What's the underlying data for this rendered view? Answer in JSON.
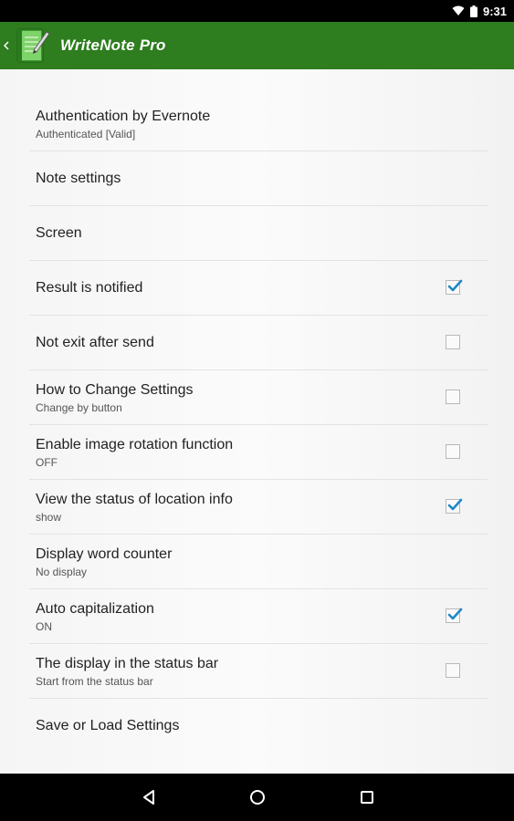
{
  "status_bar": {
    "time": "9:31",
    "icons": [
      "wifi-icon",
      "battery-icon"
    ]
  },
  "action_bar": {
    "title": "WriteNote Pro",
    "color": "#2e7d1f",
    "icons": [
      "up-chevron-icon",
      "app-notebook-icon"
    ]
  },
  "settings": [
    {
      "title": "Authentication by Evernote",
      "summary": "Authenticated [Valid]",
      "checkbox": null
    },
    {
      "title": "Note settings",
      "summary": "",
      "checkbox": null
    },
    {
      "title": "Screen",
      "summary": "",
      "checkbox": null
    },
    {
      "title": "Result is notified",
      "summary": "",
      "checkbox": true
    },
    {
      "title": "Not exit after send",
      "summary": "",
      "checkbox": false
    },
    {
      "title": "How to Change Settings",
      "summary": "Change by button",
      "checkbox": false
    },
    {
      "title": "Enable image rotation function",
      "summary": "OFF",
      "checkbox": false
    },
    {
      "title": "View the status of location info",
      "summary": "show",
      "checkbox": true
    },
    {
      "title": "Display word counter",
      "summary": "No display",
      "checkbox": null
    },
    {
      "title": "Auto capitalization",
      "summary": "ON",
      "checkbox": true
    },
    {
      "title": "The display in the status bar",
      "summary": "Start from the status bar",
      "checkbox": false
    },
    {
      "title": "Save or Load Settings",
      "summary": "",
      "checkbox": null
    }
  ],
  "colors": {
    "checkmark": "#1e88c8",
    "checkbox_border": "#b8b8b8"
  },
  "nav_bar": {
    "icons": [
      "back-icon",
      "home-icon",
      "recents-icon"
    ]
  }
}
